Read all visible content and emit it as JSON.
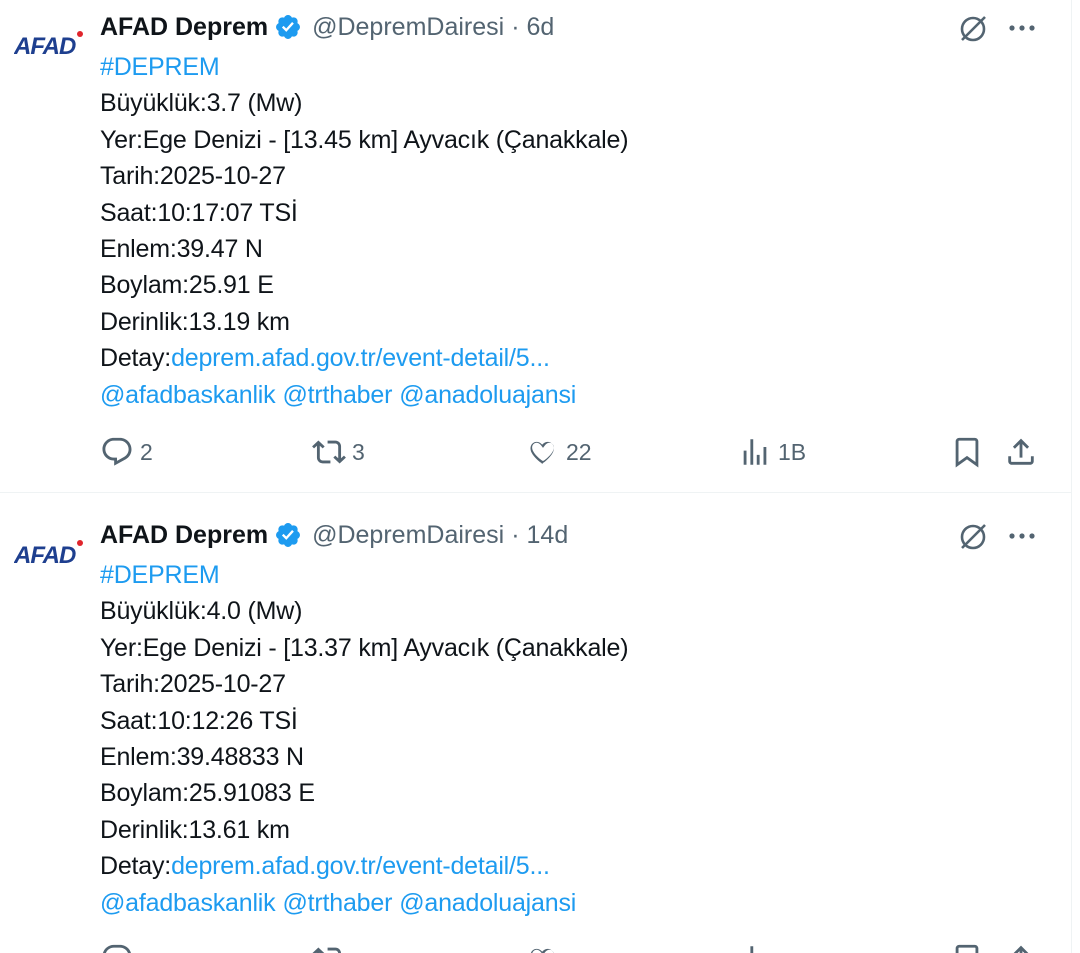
{
  "colors": {
    "accent": "#1d9bf0",
    "text": "#0f1419",
    "secondary": "#536471",
    "afad_blue": "#1e3f8f",
    "afad_red": "#e0252c"
  },
  "tweets": [
    {
      "avatar_text": "AFAD",
      "name": "AFAD Deprem",
      "handle": "@DepremDairesi",
      "separator": "·",
      "time": "6d",
      "hashtag": "#DEPREM",
      "lines": {
        "magnitude": "Büyüklük:3.7 (Mw)",
        "location": "Yer:Ege Denizi - [13.45 km] Ayvacık (Çanakkale)",
        "date": "Tarih:2025-10-27",
        "hour": "Saat:10:17:07 TSİ",
        "latitude": "Enlem:39.47 N",
        "longitude": "Boylam:25.91 E",
        "depth": "Derinlik:13.19 km",
        "detail_label": "Detay:",
        "detail_link": "deprem.afad.gov.tr/event-detail/5..."
      },
      "mentions": [
        "@afadbaskanlik",
        "@trthaber",
        "@anadoluajansi"
      ],
      "stats": {
        "replies": "2",
        "reposts": "3",
        "likes": "22",
        "views": "1B"
      }
    },
    {
      "avatar_text": "AFAD",
      "name": "AFAD Deprem",
      "handle": "@DepremDairesi",
      "separator": "·",
      "time": "14d",
      "hashtag": "#DEPREM",
      "lines": {
        "magnitude": "Büyüklük:4.0 (Mw)",
        "location": "Yer:Ege Denizi - [13.37 km] Ayvacık (Çanakkale)",
        "date": "Tarih:2025-10-27",
        "hour": "Saat:10:12:26 TSİ",
        "latitude": "Enlem:39.48833 N",
        "longitude": "Boylam:25.91083 E",
        "depth": "Derinlik:13.61 km",
        "detail_label": "Detay:",
        "detail_link": "deprem.afad.gov.tr/event-detail/5..."
      },
      "mentions": [
        "@afadbaskanlik",
        "@trthaber",
        "@anadoluajansi"
      ],
      "stats": {
        "replies": "",
        "reposts": "",
        "likes": "",
        "views": ""
      }
    }
  ]
}
